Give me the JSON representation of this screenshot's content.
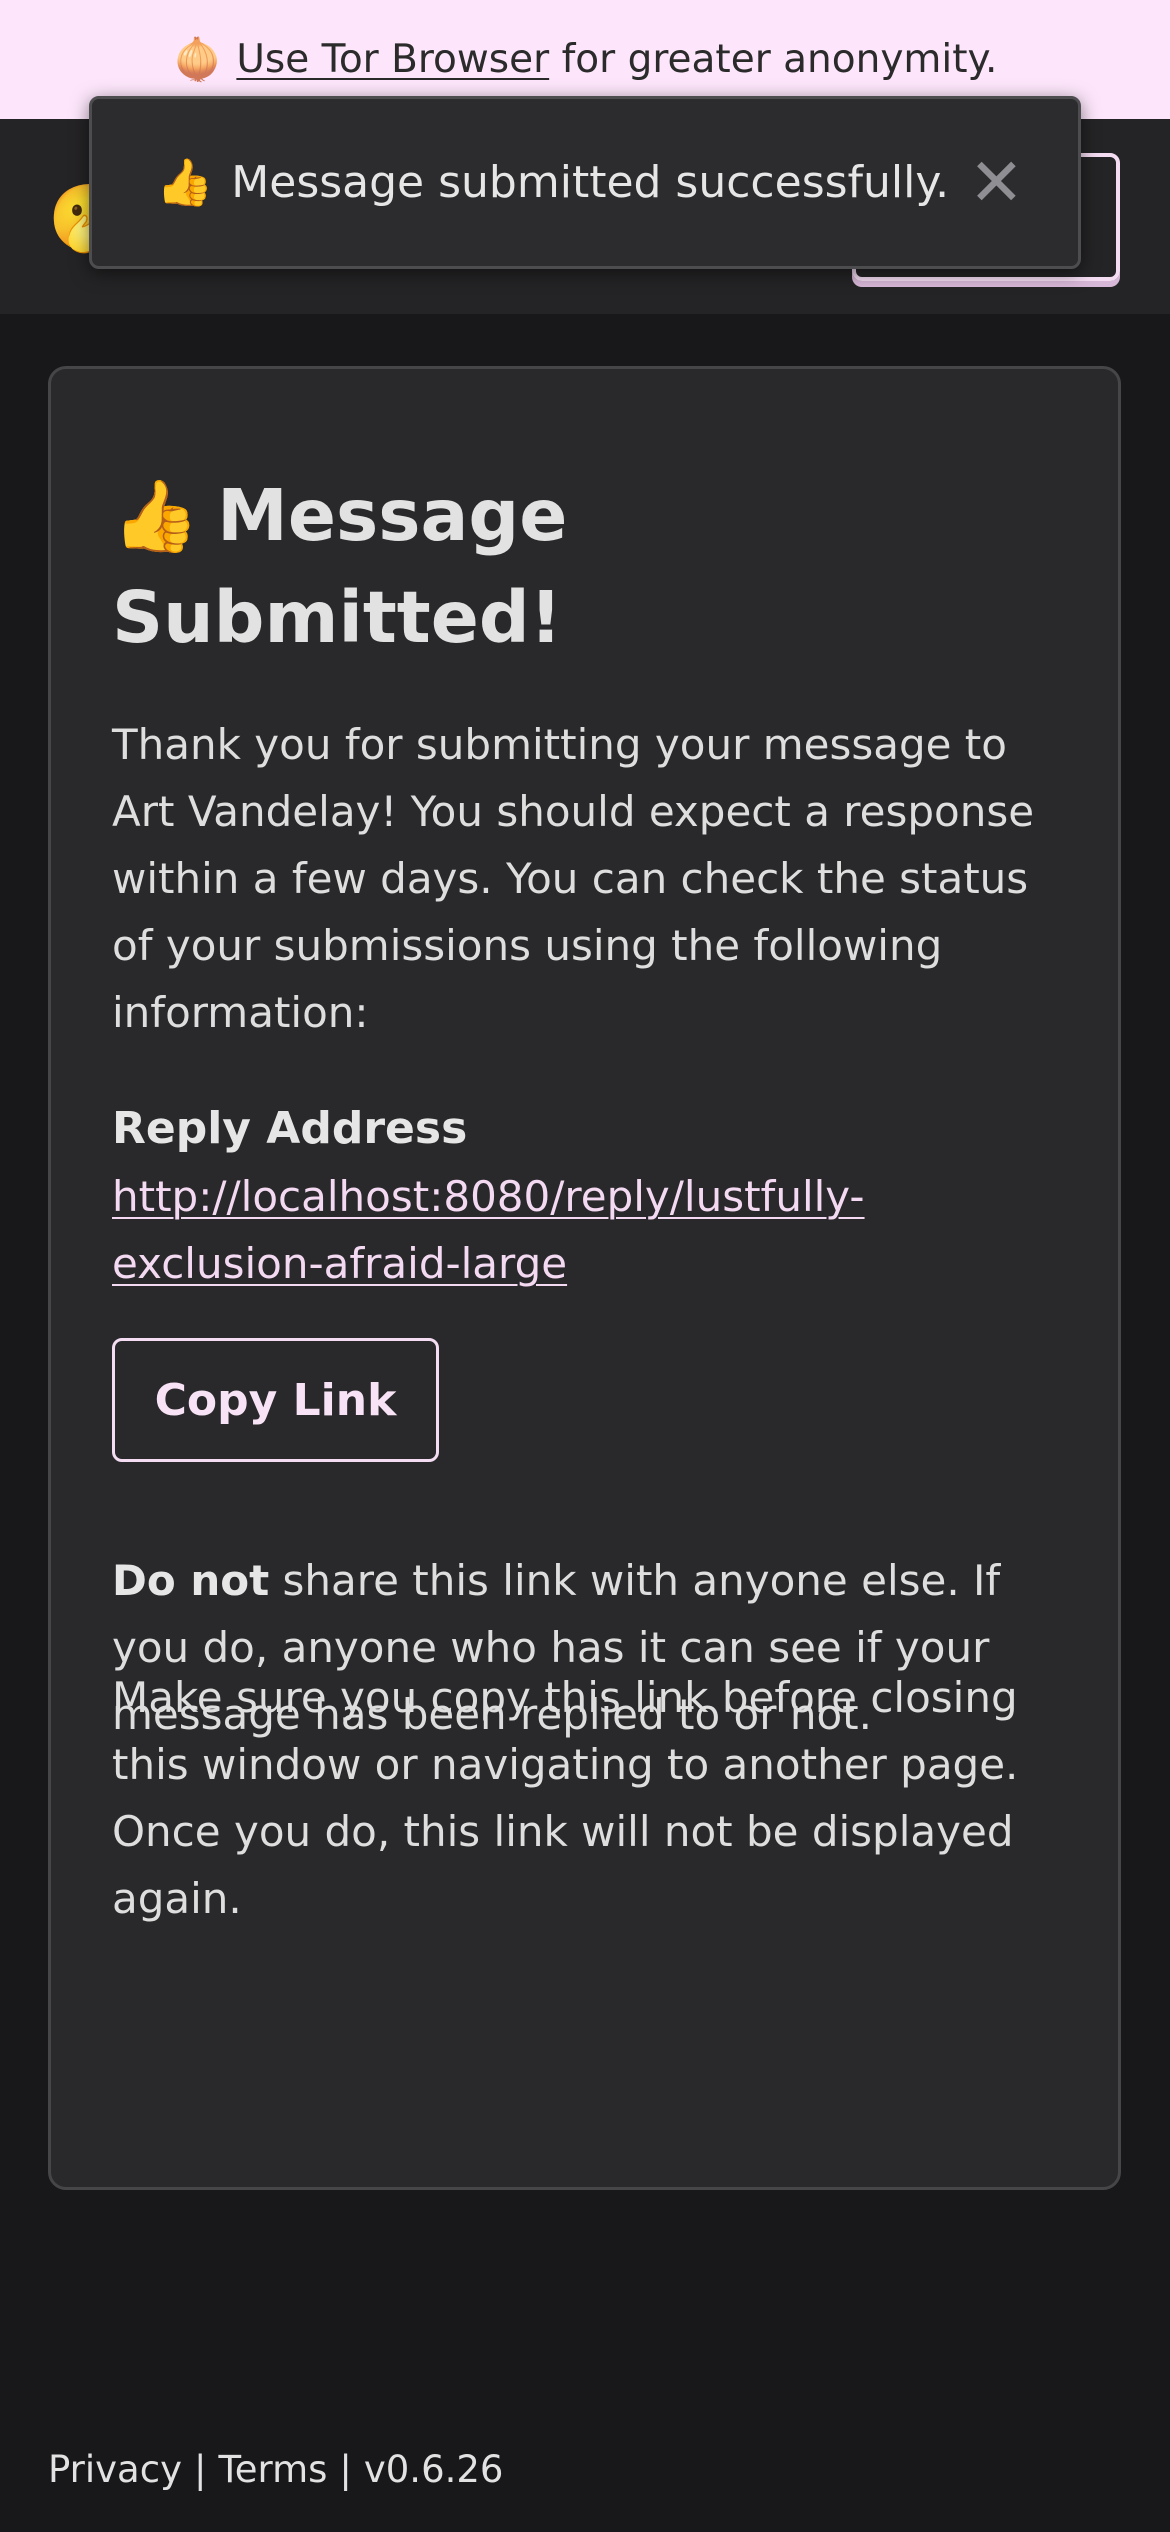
{
  "banner": {
    "icon": "onion-icon",
    "link_text": "Use Tor Browser",
    "text": "for greater anonymity."
  },
  "toast": {
    "icon": "thumbs-up-icon",
    "message": "Message submitted successfully.",
    "close_icon": "close-icon"
  },
  "header": {
    "logo_icon": "emoji-logo-icon"
  },
  "card": {
    "title": "Message Submitted!",
    "intro": "Thank you for submitting your message to Art Vandelay! You should expect a response within a few days. You can check the status of your submissions using the following information:",
    "reply_label": "Reply Address",
    "reply_url": "http://localhost:8080/reply/lustfully-exclusion-afraid-large",
    "copy_button": "Copy Link",
    "warning_bold": "Do not",
    "warning_text": "share this link with anyone else. If you do, anyone who has it can see if your message has been replied to or not.",
    "reminder": "Make sure you copy this link before closing this window or navigating to another page. Once you do, this link will not be displayed again."
  },
  "footer": {
    "privacy": "Privacy",
    "terms": "Terms",
    "version": "v0.6.26",
    "separator": "|"
  },
  "colors": {
    "banner_bg": "#fde6fb",
    "page_bg": "#18171a",
    "card_bg": "#29282a",
    "accent": "#f4dcf2"
  }
}
